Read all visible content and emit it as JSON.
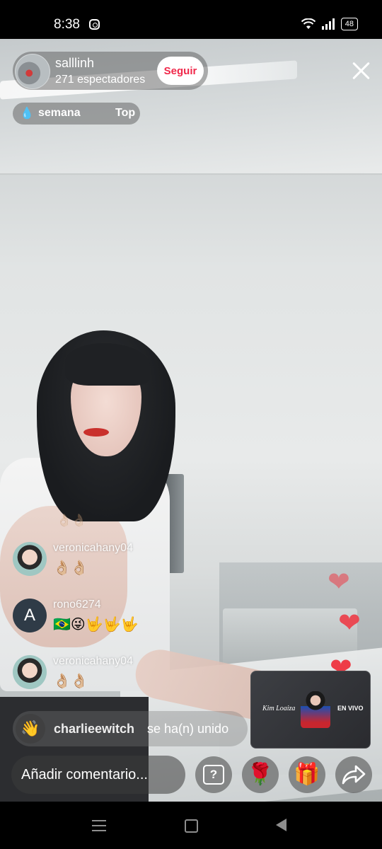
{
  "status_bar": {
    "time": "8:38",
    "battery": "48"
  },
  "host": {
    "username": "salllinh",
    "viewers": "271 espectadores",
    "follow_label": "Seguir"
  },
  "ranking": {
    "label": "semana",
    "top_label": "Top"
  },
  "ghost_comment": "👌🏼👌🏼",
  "comments": [
    {
      "username": "veronicahany04",
      "text": "👌🏼👌🏼",
      "avatar": "photo"
    },
    {
      "username": "rono6274",
      "text": "🇧🇷😜🤟🤟🤟",
      "avatar": "A"
    },
    {
      "username": "veronicahany04",
      "text": "👌🏼👌🏼",
      "avatar": "photo"
    }
  ],
  "join_notice": {
    "username": "charlieewitch",
    "text": "se ha(n) unido"
  },
  "mini_live": {
    "name": "Kim Loaiza",
    "badge": "EN VIVO"
  },
  "bottom_bar": {
    "comment_placeholder": "Añadir comentario...",
    "question_icon": "?",
    "rose_icon": "🌹",
    "gift_icon": "🎁"
  },
  "colors": {
    "follow_text": "#f0284a",
    "heart": "#ee3c47"
  }
}
